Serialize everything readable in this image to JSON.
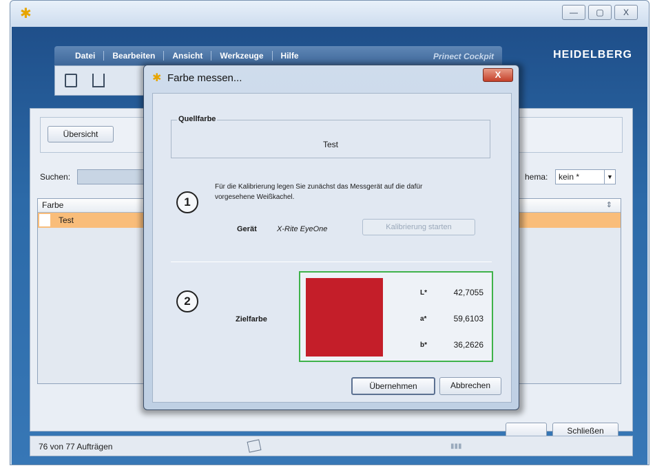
{
  "app": {
    "brand": "HEIDELBERG",
    "product": "Prinect Cockpit",
    "menu": [
      "Datei",
      "Bearbeiten",
      "Ansicht",
      "Werkzeuge",
      "Hilfe"
    ]
  },
  "window_controls": {
    "minimize": "—",
    "maximize": "▢",
    "close": "X"
  },
  "panel": {
    "overview_button": "Übersicht",
    "search_label": "Suchen:",
    "schema_label": "hema:",
    "schema_value": "kein *",
    "table": {
      "columns": [
        "Farbe"
      ],
      "rows": [
        {
          "name": "Test",
          "selected": true
        }
      ]
    },
    "close_button": "Schließen",
    "status": "76 von 77 Aufträgen"
  },
  "dialog": {
    "title": "Farbe messen...",
    "close_label": "X",
    "source": {
      "legend": "Quellfarbe",
      "value": "Test"
    },
    "step1": {
      "number": "1",
      "instruction_line1": "Für die Kalibrierung legen Sie zunächst das Messgerät auf die dafür",
      "instruction_line2": "vorgesehene Weißkachel.",
      "device_label": "Gerät",
      "device_value": "X-Rite EyeOne",
      "calibrate_button": "Kalibrierung starten"
    },
    "step2": {
      "number": "2",
      "target_label": "Zielfarbe",
      "swatch_color": "#c41e29",
      "lab": [
        {
          "key": "L*",
          "value": "42,7055"
        },
        {
          "key": "a*",
          "value": "59,6103"
        },
        {
          "key": "b*",
          "value": "36,2626"
        }
      ]
    },
    "ok_button": "Übernehmen",
    "cancel_button": "Abbrechen"
  },
  "colors": {
    "accent_frame": "#2c6aa8",
    "selection": "#f9bd7a",
    "target_border": "#3fb24a"
  }
}
